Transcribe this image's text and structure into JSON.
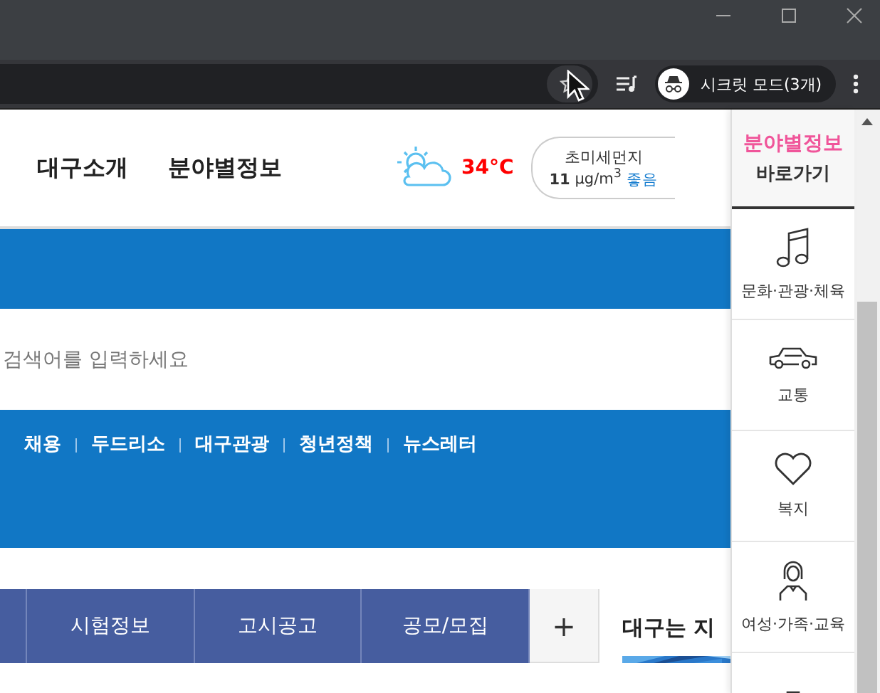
{
  "browser": {
    "profile": {
      "label": "시크릿 모드(3개)"
    }
  },
  "header": {
    "nav": [
      "대구소개",
      "분야별정보"
    ],
    "weather": {
      "temperature": "34°C"
    },
    "dust": {
      "label": "초미세먼지",
      "value": "11",
      "unit": "μg/m$^{3}$",
      "grade": "좋음"
    }
  },
  "search": {
    "placeholder": "검색어를 입력하세요"
  },
  "quick_links": [
    "채용",
    "두드리소",
    "대구관광",
    "청년정책",
    "뉴스레터"
  ],
  "tabs": [
    {
      "label": "시험정보"
    },
    {
      "label": "고시공고"
    },
    {
      "label": "공모/모집"
    }
  ],
  "more_button": "+",
  "section_title": "대구는 지",
  "sidebar": {
    "title": "분야별정보",
    "subtitle": "바로가기",
    "items": [
      {
        "label": "문화·관광·체육",
        "kind": "music"
      },
      {
        "label": "교통",
        "kind": "car"
      },
      {
        "label": "복지",
        "kind": "heart"
      },
      {
        "label": "여성·가족·교육",
        "kind": "woman"
      },
      {
        "kind": "clipboard"
      }
    ]
  }
}
